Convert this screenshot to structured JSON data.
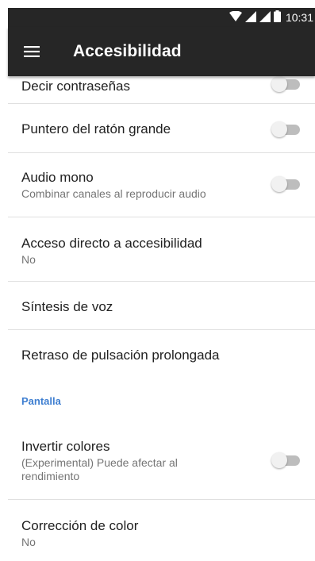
{
  "status_bar": {
    "time": "10:31",
    "icons": [
      "wifi-icon",
      "signal-icon",
      "signal-icon",
      "battery-icon"
    ]
  },
  "app_bar": {
    "menu_icon": "hamburger-menu-icon",
    "title": "Accesibilidad"
  },
  "settings": [
    {
      "id": "decir-contrasenas",
      "title": "Decir contraseñas",
      "toggle": true,
      "enabled": false
    },
    {
      "id": "puntero-grande",
      "title": "Puntero del ratón grande",
      "toggle": true,
      "enabled": false
    },
    {
      "id": "audio-mono",
      "title": "Audio mono",
      "summary": "Combinar canales al reproducir audio",
      "toggle": true,
      "enabled": false
    },
    {
      "id": "acceso-directo",
      "title": "Acceso directo a accesibilidad",
      "summary": "No"
    },
    {
      "id": "sintesis-voz",
      "title": "Síntesis de voz"
    },
    {
      "id": "retraso-pulsacion",
      "title": "Retraso de pulsación prolongada"
    }
  ],
  "section_pantalla": {
    "label": "Pantalla"
  },
  "pantalla_items": [
    {
      "id": "invertir-colores",
      "title": "Invertir colores",
      "summary_line1": "(Experimental) Puede afectar al",
      "summary_line2": "rendimiento",
      "toggle": true,
      "enabled": false
    },
    {
      "id": "correccion-color",
      "title": "Corrección de color",
      "summary": "No"
    }
  ],
  "colors": {
    "app_bar": "#262626",
    "accent": "#3f7fd1",
    "divider": "#e0e0e0"
  }
}
